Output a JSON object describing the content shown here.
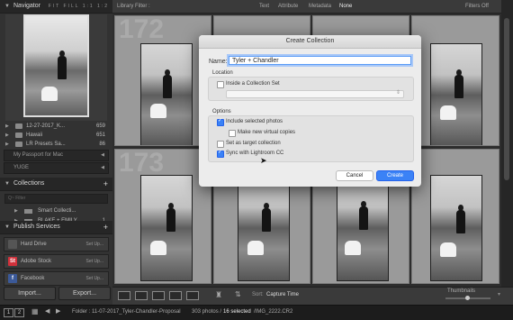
{
  "navigator": {
    "title": "Navigator",
    "zoom": "FIT  FILL  1:1  1:2"
  },
  "folders": [
    {
      "name": "12-27-2017_K...",
      "count": "659"
    },
    {
      "name": "Hawaii",
      "count": "651"
    },
    {
      "name": "LR Presets Sa...",
      "count": "86"
    }
  ],
  "volumes": [
    "My Passport for Mac",
    "YUGE"
  ],
  "collections": {
    "title": "Collections",
    "filter_placeholder": "Q~ Filter",
    "items": [
      {
        "name": "Smart Collecti...",
        "count": ""
      },
      {
        "name": "BLAKE + EMILY",
        "count": "1"
      }
    ]
  },
  "publish": {
    "title": "Publish Services",
    "items": [
      {
        "name": "Hard Drive",
        "action": "Set Up...",
        "icon": "hard-drive-icon",
        "color": "#555555",
        "glyph": ""
      },
      {
        "name": "Adobe Stock",
        "action": "Set Up...",
        "icon": "adobe-stock-icon",
        "color": "#d1313b",
        "glyph": "St"
      },
      {
        "name": "Facebook",
        "action": "Set Up...",
        "icon": "facebook-icon",
        "color": "#3b5998",
        "glyph": "f"
      }
    ]
  },
  "left_buttons": {
    "import": "Import...",
    "export": "Export..."
  },
  "library_filter": {
    "label": "Library Filter :",
    "text": "Text",
    "attribute": "Attribute",
    "metadata": "Metadata",
    "none": "None",
    "filters": "Filters Off"
  },
  "grid_numbers": [
    "172",
    "173"
  ],
  "toolbar": {
    "sort_label": "Sort:",
    "sort_value": "Capture Time",
    "thumbnails": "Thumbnails"
  },
  "status": {
    "page1": "1",
    "page2": "2",
    "folder": "Folder : 11-07-2017_Tyler-Chandler-Proposal",
    "photos": "303 photos /",
    "selected": "16 selected",
    "file": "/IMG_2222.CR2"
  },
  "dialog": {
    "title": "Create Collection",
    "name_label": "Name:",
    "name_value": "Tyler + Chandler",
    "location_label": "Location",
    "inside_set": "Inside a Collection Set",
    "options_label": "Options",
    "include_selected": "Include selected photos",
    "virtual_copies": "Make new virtual copies",
    "target": "Set as target collection",
    "sync": "Sync with Lightroom CC",
    "cancel": "Cancel",
    "create": "Create",
    "accent": "#3b82f6"
  }
}
